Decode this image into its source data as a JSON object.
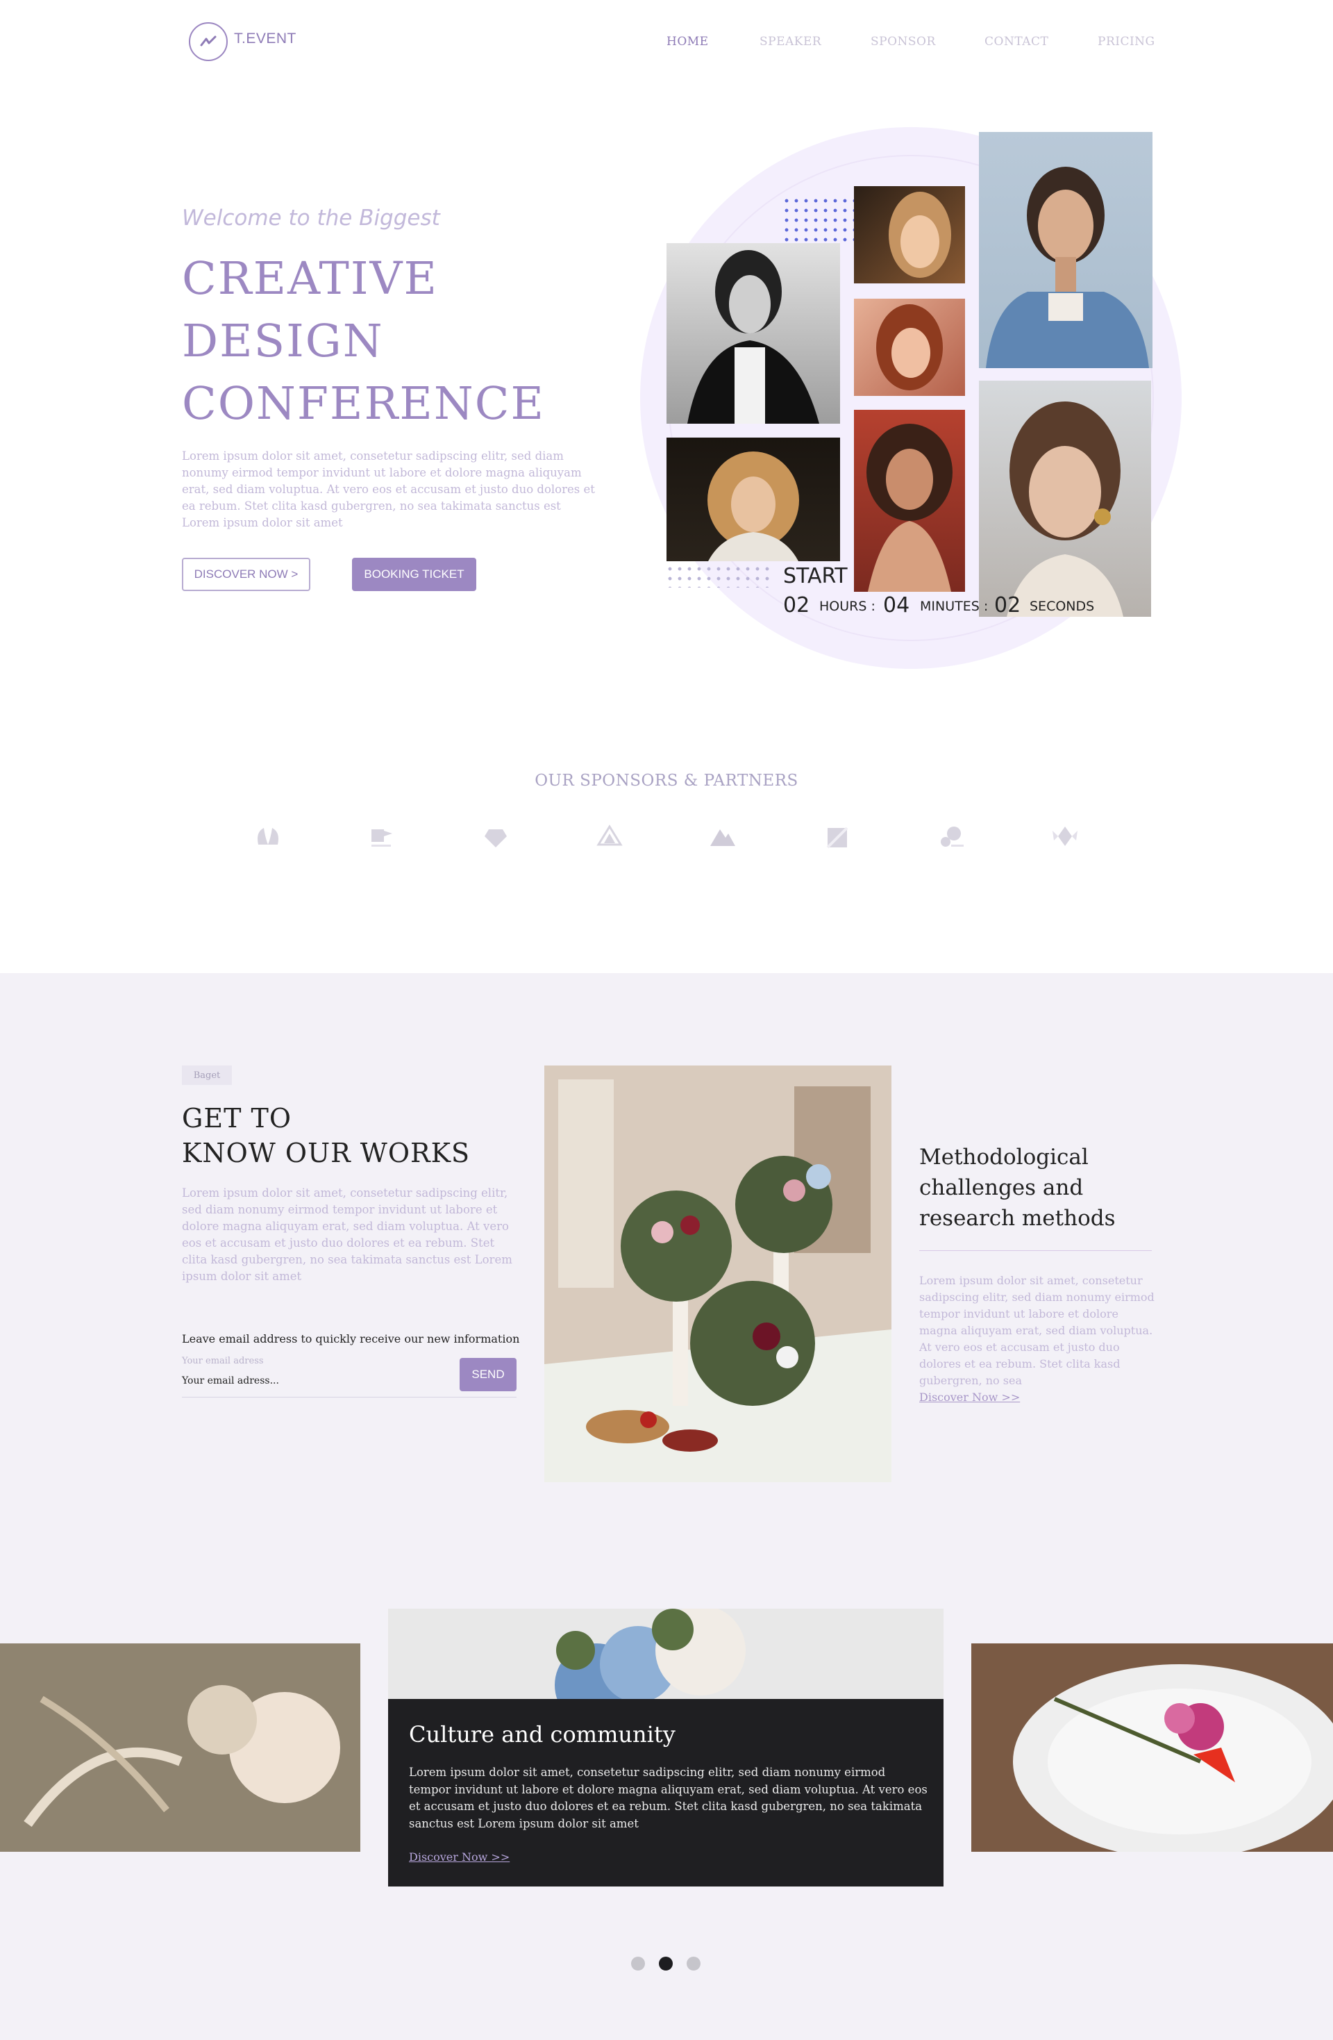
{
  "nav": {
    "brand": "T.EVENT",
    "items": [
      "HOME",
      "SPEAKER",
      "SPONSOR",
      "CONTACT",
      "PRICING"
    ],
    "active": "HOME"
  },
  "hero": {
    "welcome": "Welcome to the Biggest",
    "title_lines": [
      "CREATIVE",
      "DESIGN",
      "CONFERENCE"
    ],
    "description": "Lorem ipsum dolor sit amet, consetetur sadipscing elitr, sed diam nonumy eirmod tempor invidunt ut labore et dolore magna aliquyam erat, sed diam voluptua. At vero eos et accusam et justo duo dolores et ea rebum. Stet clita kasd gubergren, no sea takimata sanctus est Lorem ipsum dolor sit amet",
    "discover_label": "DISCOVER NOW >",
    "booking_label": "BOOKING TICKET"
  },
  "countdown": {
    "start_label": "START",
    "hours": "02",
    "hours_label": "HOURS :",
    "minutes": "04",
    "minutes_label": "MINUTES :",
    "seconds": "02",
    "seconds_label": "SECONDS"
  },
  "sponsors": {
    "title": "OUR SPONSORS & PARTNERS",
    "logos": [
      "leaf-logo",
      "square-flag-logo",
      "gem-logo",
      "triangle-logo",
      "mountain-logo",
      "box-logo",
      "bubble-logo",
      "diamond-wings-logo"
    ]
  },
  "works": {
    "badge": "Baget",
    "title_lines": [
      "GET TO",
      "KNOW OUR WORKS"
    ],
    "description": "Lorem ipsum dolor sit amet, consetetur sadipscing elitr, sed diam nonumy eirmod tempor invidunt ut labore et dolore magna aliquyam erat, sed diam voluptua. At vero eos et accusam et justo duo dolores et ea rebum. Stet clita kasd gubergren, no sea takimata sanctus est Lorem ipsum dolor sit amet",
    "email_label": "Leave email address to quickly receive our  new information",
    "email_placeholder": "Your email adress",
    "email_value": "Your email adress...",
    "send_label": "SEND"
  },
  "method": {
    "title_lines": [
      "Methodological",
      "challenges and",
      "research methods"
    ],
    "description": "Lorem ipsum dolor sit amet, consetetur sadipscing elitr, sed diam nonumy eirmod tempor invidunt ut labore et dolore magna aliquyam erat, sed diam voluptua. At vero eos et accusam et justo duo dolores et ea rebum. Stet clita kasd gubergren, no sea",
    "link": "Discover Now >>"
  },
  "carousel": {
    "card_title": "Culture and community",
    "card_description": "Lorem ipsum dolor sit amet, consetetur sadipscing elitr, sed diam nonumy eirmod tempor invidunt ut labore et dolore magna aliquyam erat, sed diam voluptua. At vero eos et accusam et justo duo dolores et ea rebum. Stet clita kasd gubergren, no sea takimata sanctus est Lorem ipsum dolor sit amet",
    "card_link": "Discover Now >>",
    "active_dot": 1,
    "dots": 3
  },
  "colors": {
    "accent": "#9c88c2",
    "accent_text": "#8e7bb6",
    "muted_text": "#c2b8d8",
    "section_bg": "#f3f1f7",
    "dark_card": "#1f1f22"
  }
}
